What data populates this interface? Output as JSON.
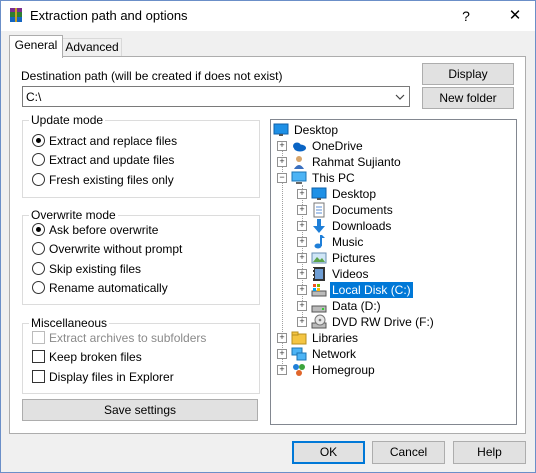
{
  "window": {
    "title": "Extraction path and options",
    "help_glyph": "?",
    "close_glyph": "✕"
  },
  "tabs": [
    {
      "label": "General"
    },
    {
      "label": "Advanced"
    }
  ],
  "destination": {
    "label": "Destination path (will be created if does not exist)",
    "value": "C:\\",
    "display_button": "Display",
    "new_folder_button": "New folder"
  },
  "update_mode": {
    "title": "Update mode",
    "options": [
      {
        "label": "Extract and replace files",
        "selected": true
      },
      {
        "label": "Extract and update files",
        "selected": false
      },
      {
        "label": "Fresh existing files only",
        "selected": false
      }
    ]
  },
  "overwrite_mode": {
    "title": "Overwrite mode",
    "options": [
      {
        "label": "Ask before overwrite",
        "selected": true
      },
      {
        "label": "Overwrite without prompt",
        "selected": false
      },
      {
        "label": "Skip existing files",
        "selected": false
      },
      {
        "label": "Rename automatically",
        "selected": false
      }
    ]
  },
  "misc": {
    "title": "Miscellaneous",
    "options": [
      {
        "label": "Extract archives to subfolders",
        "checked": false,
        "disabled": true
      },
      {
        "label": "Keep broken files",
        "checked": false,
        "disabled": false
      },
      {
        "label": "Display files in Explorer",
        "checked": false,
        "disabled": false
      }
    ]
  },
  "save_settings_button": "Save settings",
  "tree": [
    {
      "label": "Desktop",
      "icon": "desktop-icon"
    },
    {
      "label": "OneDrive",
      "icon": "onedrive-icon"
    },
    {
      "label": "Rahmat Sujianto",
      "icon": "user-icon"
    },
    {
      "label": "This PC",
      "icon": "computer-icon"
    },
    {
      "label": "Desktop",
      "icon": "desktop-icon"
    },
    {
      "label": "Documents",
      "icon": "documents-icon"
    },
    {
      "label": "Downloads",
      "icon": "downloads-icon"
    },
    {
      "label": "Music",
      "icon": "music-icon"
    },
    {
      "label": "Pictures",
      "icon": "pictures-icon"
    },
    {
      "label": "Videos",
      "icon": "videos-icon"
    },
    {
      "label": "Local Disk (C:)",
      "icon": "local-disk-icon",
      "selected": true
    },
    {
      "label": "Data (D:)",
      "icon": "drive-icon"
    },
    {
      "label": "DVD RW Drive (F:)",
      "icon": "dvd-drive-icon"
    },
    {
      "label": "Libraries",
      "icon": "libraries-icon"
    },
    {
      "label": "Network",
      "icon": "network-icon"
    },
    {
      "label": "Homegroup",
      "icon": "homegroup-icon"
    }
  ],
  "footer": {
    "ok": "OK",
    "cancel": "Cancel",
    "help": "Help"
  },
  "colors": {
    "selection": "#0078d7",
    "accent_border": "#0078d7"
  }
}
